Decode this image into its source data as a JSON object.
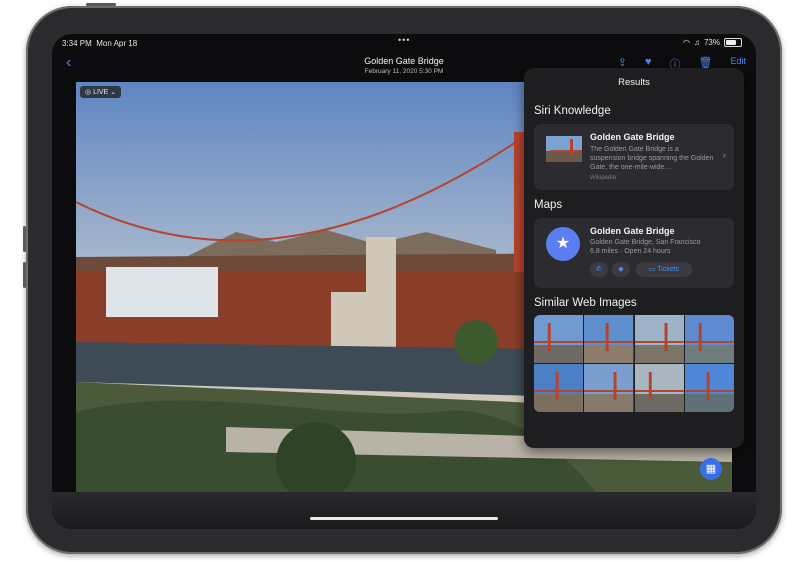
{
  "status_bar": {
    "time": "3:34 PM",
    "date": "Mon Apr 18",
    "dots": "•••",
    "battery": "73%",
    "battery_level": 0.73
  },
  "nav": {
    "back_icon": "chevron-left-icon",
    "title": "Golden Gate Bridge",
    "subtitle": "February 11, 2020   5:30 PM",
    "edit": "Edit"
  },
  "photo": {
    "live_badge": "LIVE"
  },
  "results": {
    "title": "Results",
    "siri_heading": "Siri Knowledge",
    "siri": {
      "title": "Golden Gate Bridge",
      "description": "The Golden Gate Bridge is a suspension bridge spanning the Golden Gate, the one-mile-wide…",
      "source": "Wikipedia"
    },
    "maps_heading": "Maps",
    "maps": {
      "title": "Golden Gate Bridge",
      "line1": "Golden Gate Bridge, San Francisco",
      "line2": "6.8 miles · Open 24 hours",
      "tickets": "Tickets"
    },
    "similar_heading": "Similar Web Images",
    "thumbnails": [
      {
        "sky": "#6f9bd0",
        "ground": "#6e6a63"
      },
      {
        "sky": "#5e8fcc",
        "ground": "#8b7c6b"
      },
      {
        "sky": "#9fb3c7",
        "ground": "#7a7468"
      },
      {
        "sky": "#5d8ad0",
        "ground": "#6f7c7a"
      },
      {
        "sky": "#4d7fc7",
        "ground": "#7d6f5f"
      },
      {
        "sky": "#7a9fcf",
        "ground": "#857a6c"
      },
      {
        "sky": "#a9b6c2",
        "ground": "#6e6962"
      },
      {
        "sky": "#4f86d6",
        "ground": "#5f7177"
      }
    ]
  },
  "colors": {
    "accent": "#4a8cf7",
    "bridge": "#b5442e"
  }
}
